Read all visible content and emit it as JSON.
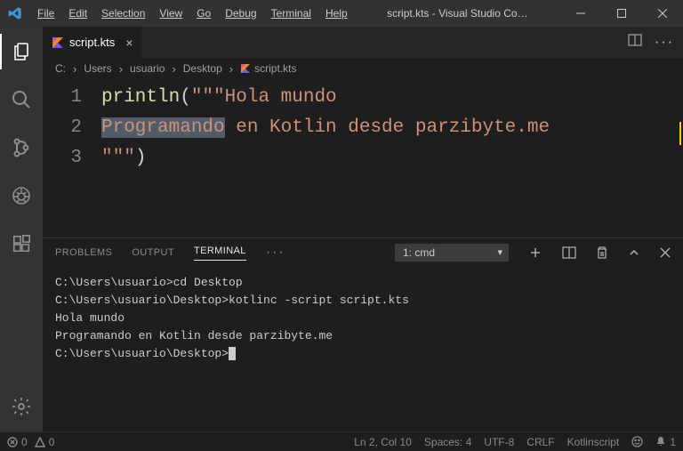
{
  "menu": {
    "file": "File",
    "edit": "Edit",
    "selection": "Selection",
    "view": "View",
    "go": "Go",
    "debug": "Debug",
    "terminal": "Terminal",
    "help": "Help"
  },
  "window_title": "script.kts - Visual Studio Co…",
  "tab": {
    "label": "script.kts"
  },
  "breadcrumb": {
    "c0": "C:",
    "c1": "Users",
    "c2": "usuario",
    "c3": "Desktop",
    "c4": "script.kts"
  },
  "code": {
    "ln1": "1",
    "ln2": "2",
    "ln3": "3",
    "l1_fn": "println",
    "l1_paren": "(",
    "l1_q": "\"\"\"",
    "l1_str": "Hola mundo",
    "l2_pre": "Programando",
    "l2_rest": " en Kotlin desde parzibyte.me",
    "l3_q": "\"\"\"",
    "l3_close": ")"
  },
  "panel": {
    "problems": "PROBLEMS",
    "output": "OUTPUT",
    "terminal": "TERMINAL",
    "more": "···",
    "shell": "1: cmd"
  },
  "term": {
    "l1": "C:\\Users\\usuario>cd Desktop",
    "l2": "",
    "l3": "C:\\Users\\usuario\\Desktop>kotlinc -script script.kts",
    "l4": "Hola mundo",
    "l5": "Programando en Kotlin desde parzibyte.me",
    "l6": "",
    "l7": "C:\\Users\\usuario\\Desktop>"
  },
  "status": {
    "errors": "0",
    "warnings": "0",
    "lncol": "Ln 2, Col 10",
    "spaces": "Spaces: 4",
    "enc": "UTF-8",
    "eol": "CRLF",
    "lang": "Kotlinscript",
    "bell": "1"
  }
}
